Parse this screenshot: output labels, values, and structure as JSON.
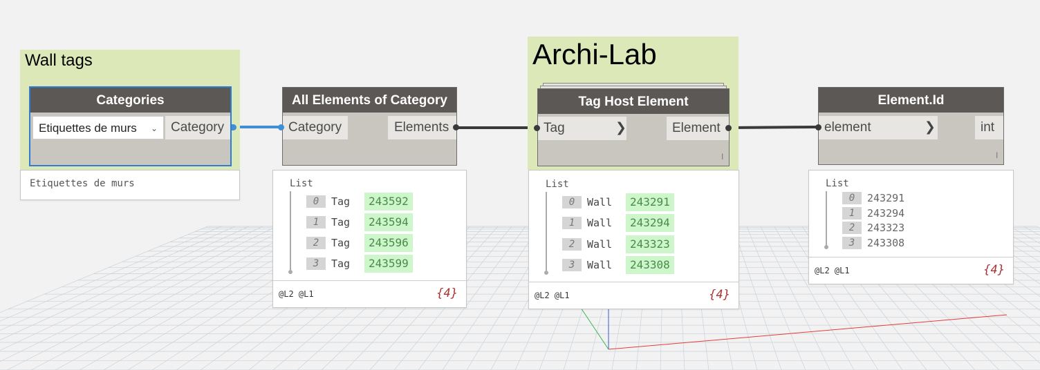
{
  "colors": {
    "canvas": "#f2f2f2",
    "group_background": "#dde8b9",
    "node_header": "#5b5856",
    "node_body": "#c9c5bf",
    "selected_border": "#2f7dd1",
    "wire_selected": "#3f8fd6",
    "wire": "#3a3a3a",
    "value_highlight": "#cdf7cb"
  },
  "groups": {
    "wall_tags": {
      "title": "Wall tags"
    },
    "archi_lab": {
      "title": "Archi-Lab"
    }
  },
  "categories_node": {
    "title": "Categories",
    "dropdown_value": "Etiquettes de murs",
    "dropdown_icon": "chevron-down-icon",
    "output": "Category",
    "preview": "Etiquettes de murs"
  },
  "all_elements_node": {
    "title": "All Elements of Category",
    "input": "Category",
    "output": "Elements",
    "preview": {
      "header": "List",
      "items": [
        {
          "index": "0",
          "type": "Tag",
          "value": "243592"
        },
        {
          "index": "1",
          "type": "Tag",
          "value": "243594"
        },
        {
          "index": "2",
          "type": "Tag",
          "value": "243596"
        },
        {
          "index": "3",
          "type": "Tag",
          "value": "243599"
        }
      ],
      "levels": "@L2 @L1",
      "count": "{4}"
    }
  },
  "tag_host_node": {
    "title": "Tag Host Element",
    "input": "Tag",
    "output": "Element",
    "lacing": "l",
    "preview": {
      "header": "List",
      "items": [
        {
          "index": "0",
          "type": "Wall",
          "value": "243291"
        },
        {
          "index": "1",
          "type": "Wall",
          "value": "243294"
        },
        {
          "index": "2",
          "type": "Wall",
          "value": "243323"
        },
        {
          "index": "3",
          "type": "Wall",
          "value": "243308"
        }
      ],
      "levels": "@L2 @L1",
      "count": "{4}"
    }
  },
  "element_id_node": {
    "title": "Element.Id",
    "input": "element",
    "output": "int",
    "lacing": "l",
    "preview": {
      "header": "List",
      "items": [
        {
          "index": "0",
          "value": "243291"
        },
        {
          "index": "1",
          "value": "243294"
        },
        {
          "index": "2",
          "value": "243323"
        },
        {
          "index": "3",
          "value": "243308"
        }
      ],
      "levels": "@L2 @L1",
      "count": "{4}"
    }
  }
}
